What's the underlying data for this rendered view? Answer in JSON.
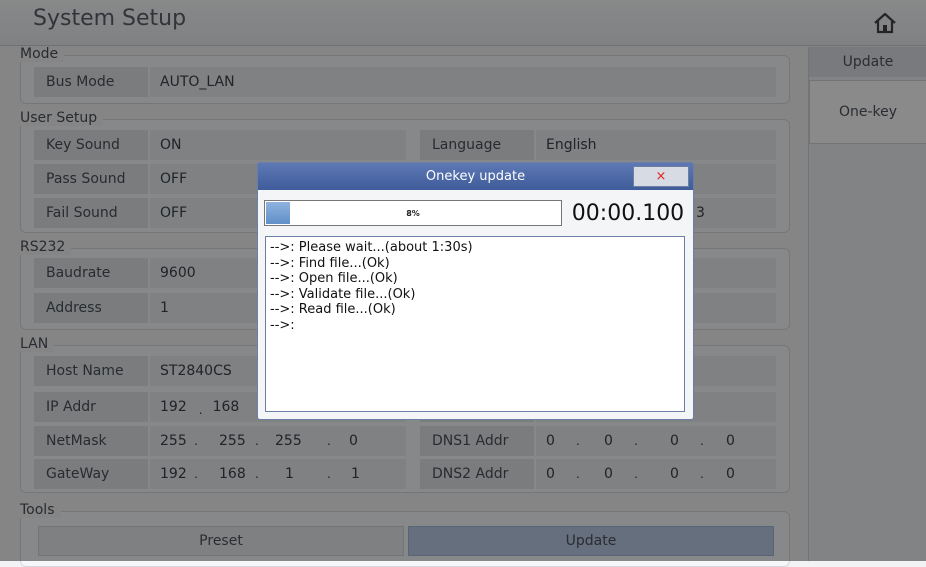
{
  "app_title": "System Setup",
  "side": {
    "update": "Update",
    "onekey": "One-key"
  },
  "groups": {
    "mode": "Mode",
    "user_setup": "User Setup",
    "rs232": "RS232",
    "lan": "LAN",
    "tools": "Tools"
  },
  "mode": {
    "bus_mode_label": "Bus Mode",
    "bus_mode_value": "AUTO_LAN"
  },
  "user_setup": {
    "key_sound_label": "Key Sound",
    "key_sound_value": "ON",
    "pass_sound_label": "Pass Sound",
    "pass_sound_value": "OFF",
    "fail_sound_label": "Fail Sound",
    "fail_sound_value": "OFF",
    "language_label": "Language",
    "language_value": "English",
    "partial_value": "3"
  },
  "rs232": {
    "baudrate_label": "Baudrate",
    "baudrate_value": "9600",
    "address_label": "Address",
    "address_value": "1"
  },
  "lan": {
    "host_name_label": "Host Name",
    "host_name_value": "ST2840CS",
    "ip_label": "IP Addr",
    "ip": [
      "192",
      "168"
    ],
    "netmask_label": "NetMask",
    "netmask": [
      "255",
      "255",
      "255",
      "0"
    ],
    "gateway_label": "GateWay",
    "gateway": [
      "192",
      "168",
      "1",
      "1"
    ],
    "dns1_label": "DNS1 Addr",
    "dns1": [
      "0",
      "0",
      "0",
      "0"
    ],
    "dns2_label": "DNS2 Addr",
    "dns2": [
      "0",
      "0",
      "0",
      "0"
    ]
  },
  "tools": {
    "preset": "Preset",
    "update": "Update"
  },
  "dialog": {
    "title": "Onekey update",
    "close": "×",
    "progress_text": "8%",
    "progress_value": 0.08,
    "timer": "00:00.100",
    "log": [
      "-->: Please wait...(about 1:30s)",
      "-->: Find file...(Ok)",
      "-->: Open file...(Ok)",
      "-->: Validate file...(Ok)",
      "-->: Read file...(Ok)",
      "-->:"
    ]
  },
  "colors": {
    "dialog_title": "#4a66a6",
    "progress": "#6f9bd1",
    "close_x": "#e02424"
  },
  "icons": {
    "home": "home-icon"
  }
}
